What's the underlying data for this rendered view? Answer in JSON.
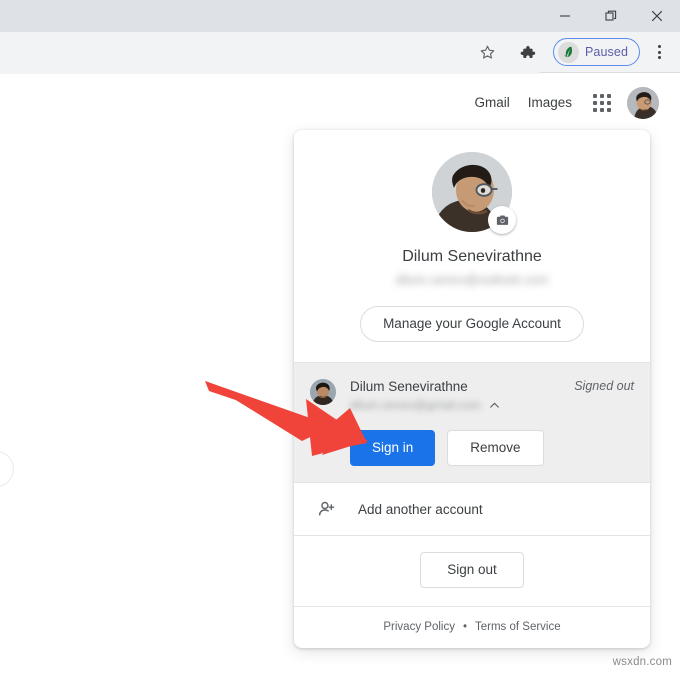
{
  "window": {
    "controls": [
      {
        "name": "minimize",
        "label": "Minimize"
      },
      {
        "name": "restore",
        "label": "Restore"
      },
      {
        "name": "close",
        "label": "Close"
      }
    ]
  },
  "toolbar": {
    "bookmark_icon": "star-icon",
    "extensions_icon": "puzzle-piece-icon",
    "extension_badge": {
      "label": "Paused",
      "icon": "grammarly-leaf-icon",
      "border_color": "#5b8def",
      "text_color": "#5b5fa8"
    },
    "menu_icon": "three-dots-vertical-icon"
  },
  "google_header": {
    "links": [
      {
        "label": "Gmail",
        "name": "gmail-link"
      },
      {
        "label": "Images",
        "name": "images-link"
      }
    ],
    "apps_icon": "google-apps-grid-icon",
    "avatar": "account-avatar"
  },
  "account_card": {
    "profile": {
      "avatar": "profile-photo",
      "camera_badge_icon": "camera-icon",
      "name": "Dilum Senevirathne",
      "email": "dilum.senev@outlook.com",
      "email_blurred": true
    },
    "manage_button": "Manage your Google Account",
    "signed_out_account": {
      "avatar": "secondary-account-photo",
      "name": "Dilum Senevirathne",
      "email": "dilum.senev@gmail.com",
      "email_blurred": true,
      "status": "Signed out",
      "collapse_icon": "chevron-up-icon",
      "sign_in_button": "Sign in",
      "remove_button": "Remove",
      "row_background": "#eeeeee",
      "sign_in_color": "#1a73e8"
    },
    "add_account": {
      "icon": "person-add-icon",
      "label": "Add another account"
    },
    "sign_out_button": "Sign out",
    "footer": {
      "privacy": "Privacy Policy",
      "separator": "•",
      "terms": "Terms of Service"
    }
  },
  "annotation": {
    "arrow": {
      "name": "red-arrow-annotation",
      "color": "#f0433a",
      "points_to": "Sign in"
    }
  },
  "watermark": "wsxdn.com"
}
